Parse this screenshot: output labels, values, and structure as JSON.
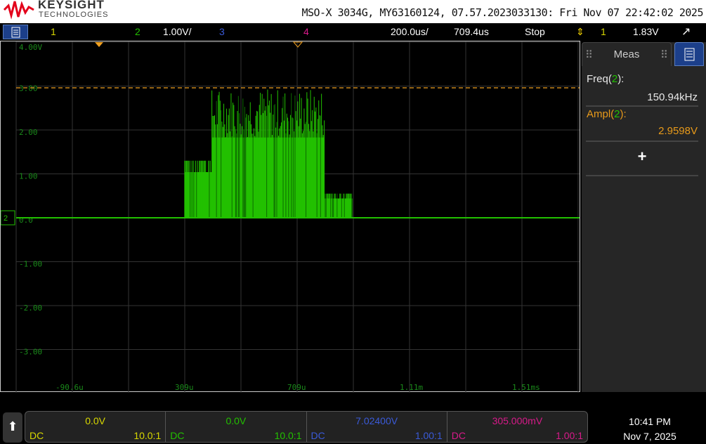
{
  "header": {
    "brand": "KEYSIGHT",
    "brand_sub": "TECHNOLOGIES",
    "instrument_info": "MSO-X 3034G, MY63160124, 07.57.2023033130: Fri Nov 07 22:42:02 2025"
  },
  "topbar": {
    "ch1": "1",
    "ch2": "2",
    "ch2_scale": "1.00V/",
    "ch3": "3",
    "ch4": "4",
    "timebase": "200.0us/",
    "delay": "709.4us",
    "run_state": "Stop",
    "trigger_source": "1",
    "trigger_level": "1.83V"
  },
  "plot": {
    "y_labels": [
      "4.00V",
      "3.00",
      "2.00",
      "1.00",
      "0.0",
      "-1.00",
      "-2.00",
      "-3.00"
    ],
    "x_labels": [
      "-90.6u",
      "309u",
      "709u",
      "1.11m",
      "1.51ms"
    ],
    "ground_marker": "2",
    "trace": {
      "color": "#22c000",
      "segments": [
        {
          "t0": 309,
          "t1": 406,
          "vmax": 1.3
        },
        {
          "t0": 406,
          "t1": 806,
          "vmax": 2.95
        },
        {
          "t0": 806,
          "t1": 906,
          "vmax": 0.55
        }
      ]
    },
    "cursor_level_v": 2.96
  },
  "meas": {
    "title": "Meas",
    "items": [
      {
        "label": "Freq(",
        "ch": "2",
        "suffix": "):",
        "value": "150.94kHz",
        "color": "#e8e8e8"
      },
      {
        "label": "Ampl(",
        "ch": "2",
        "suffix": "):",
        "value": "2.9598V",
        "color": "#e89a1a"
      }
    ],
    "add": "+"
  },
  "channels": [
    {
      "value": "0.0V",
      "coupling": "DC",
      "probe": "10.0:1",
      "color": "#d8d800"
    },
    {
      "value": "0.0V",
      "coupling": "DC",
      "probe": "10.0:1",
      "color": "#22c000"
    },
    {
      "value": "7.02400V",
      "coupling": "DC",
      "probe": "1.00:1",
      "color": "#3a5ad8"
    },
    {
      "value": "305.000mV",
      "coupling": "DC",
      "probe": "1.00:1",
      "color": "#d81a8a"
    }
  ],
  "clock": {
    "time": "10:41 PM",
    "date": "Nov 7, 2025"
  },
  "colors": {
    "ch1": "#d8d800",
    "ch2": "#22c000",
    "ch3": "#3a5ad8",
    "ch4": "#d81a8a",
    "trigger": "#f0a020"
  }
}
